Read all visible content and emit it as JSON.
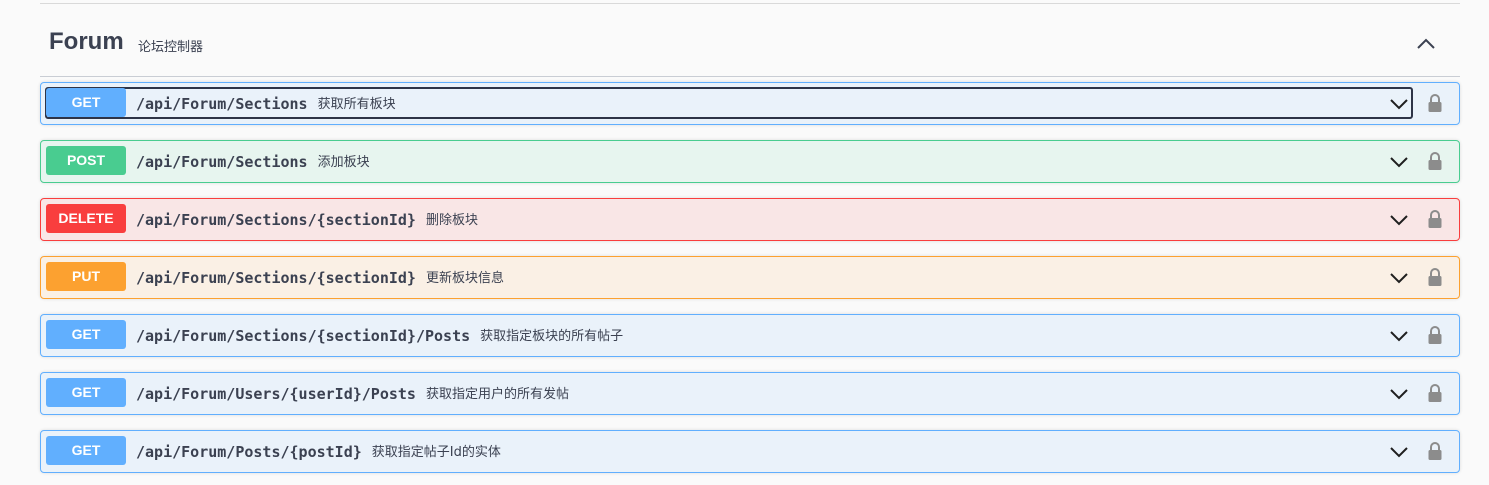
{
  "tag": {
    "name": "Forum",
    "description": "论坛控制器"
  },
  "colors": {
    "get": "#61afe",
    "post": "#49cc90",
    "delete": "#f93e3e",
    "put": "#fca130",
    "text": "#3b4151"
  },
  "icons": {
    "collapse": "chevron-up-icon",
    "expand": "chevron-down-icon",
    "auth": "lock-icon"
  },
  "operations": [
    {
      "method": "GET",
      "path": "/api/Forum/Sections",
      "summary": "获取所有板块"
    },
    {
      "method": "POST",
      "path": "/api/Forum/Sections",
      "summary": "添加板块"
    },
    {
      "method": "DELETE",
      "path": "/api/Forum/Sections/{sectionId}",
      "summary": "删除板块"
    },
    {
      "method": "PUT",
      "path": "/api/Forum/Sections/{sectionId}",
      "summary": "更新板块信息"
    },
    {
      "method": "GET",
      "path": "/api/Forum/Sections/{sectionId}/Posts",
      "summary": "获取指定板块的所有帖子"
    },
    {
      "method": "GET",
      "path": "/api/Forum/Users/{userId}/Posts",
      "summary": "获取指定用户的所有发帖"
    },
    {
      "method": "GET",
      "path": "/api/Forum/Posts/{postId}",
      "summary": "获取指定帖子Id的实体"
    }
  ]
}
